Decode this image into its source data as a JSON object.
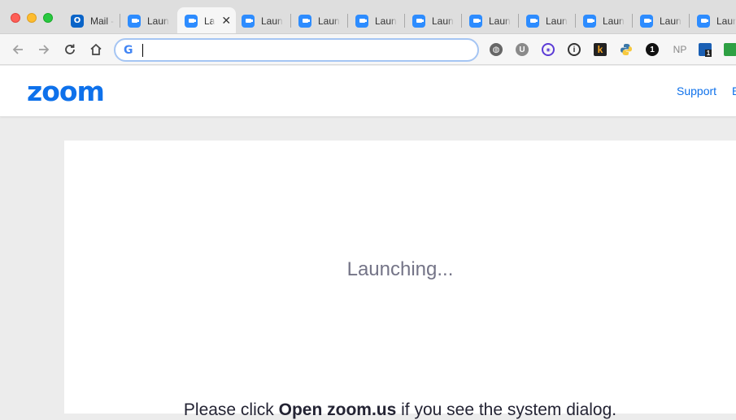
{
  "window": {
    "tabs": [
      {
        "label": "Mail -",
        "favicon": "outlook-icon",
        "active": false
      },
      {
        "label": "Laun",
        "favicon": "zoom-icon",
        "active": false
      },
      {
        "label": "La",
        "favicon": "zoom-icon",
        "active": true
      },
      {
        "label": "Laun",
        "favicon": "zoom-icon",
        "active": false
      },
      {
        "label": "Laun",
        "favicon": "zoom-icon",
        "active": false
      },
      {
        "label": "Laun",
        "favicon": "zoom-icon",
        "active": false
      },
      {
        "label": "Laun",
        "favicon": "zoom-icon",
        "active": false
      },
      {
        "label": "Laun",
        "favicon": "zoom-icon",
        "active": false
      },
      {
        "label": "Laun",
        "favicon": "zoom-icon",
        "active": false
      },
      {
        "label": "Laun",
        "favicon": "zoom-icon",
        "active": false
      },
      {
        "label": "Laun",
        "favicon": "zoom-icon",
        "active": false
      },
      {
        "label": "Laun",
        "favicon": "zoom-icon",
        "active": false
      }
    ],
    "active_tab_close": "✕"
  },
  "toolbar": {
    "back_icon": "arrow-left-icon",
    "forward_icon": "arrow-right-icon",
    "reload_icon": "reload-icon",
    "home_icon": "home-icon",
    "omnibox_provider": "G",
    "omnibox_value": "",
    "extensions": {
      "e1": "◍",
      "e2": "U",
      "e3": "◉",
      "e4": "i",
      "e5": "k",
      "e6": "python-icon",
      "e7": "1",
      "e8": "NP",
      "e9": "1",
      "e10": "green-extension-icon"
    }
  },
  "site": {
    "logo": "zoom",
    "nav": {
      "support": "Support",
      "next_partial": "E"
    },
    "brand_color": "#0e71eb"
  },
  "content": {
    "status": "Launching...",
    "instruction_prefix": "Please click ",
    "instruction_bold": "Open zoom.us",
    "instruction_suffix": " if you see the system dialog."
  }
}
